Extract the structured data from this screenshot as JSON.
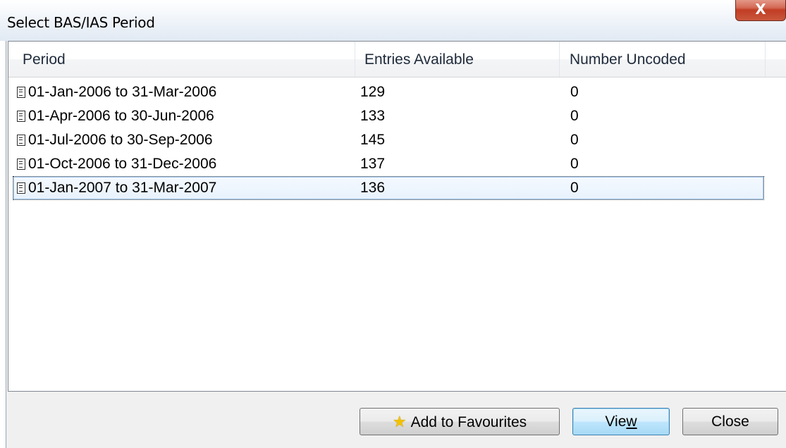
{
  "window": {
    "title": "Select BAS/IAS Period",
    "close_glyph": "X"
  },
  "table": {
    "columns": [
      "Period",
      "Entries Available",
      "Number Uncoded"
    ],
    "rows": [
      {
        "period": "01-Jan-2006 to 31-Mar-2006",
        "entries": "129",
        "uncoded": "0"
      },
      {
        "period": "01-Apr-2006 to 30-Jun-2006",
        "entries": "133",
        "uncoded": "0"
      },
      {
        "period": "01-Jul-2006 to 30-Sep-2006",
        "entries": "145",
        "uncoded": "0"
      },
      {
        "period": "01-Oct-2006 to 31-Dec-2006",
        "entries": "137",
        "uncoded": "0"
      },
      {
        "period": "01-Jan-2007 to 31-Mar-2007",
        "entries": "136",
        "uncoded": "0",
        "selected": true
      }
    ],
    "row_icon": "document-icon"
  },
  "buttons": {
    "favourites": {
      "label": "Add to Favourites",
      "icon": "star-icon"
    },
    "view": {
      "label_prefix": "Vie",
      "label_mnemonic": "w"
    },
    "close": {
      "label": "Close"
    }
  },
  "colors": {
    "selection": "#e8f2fd",
    "default_button": "#bee6fd",
    "close_button": "#c9573c"
  }
}
